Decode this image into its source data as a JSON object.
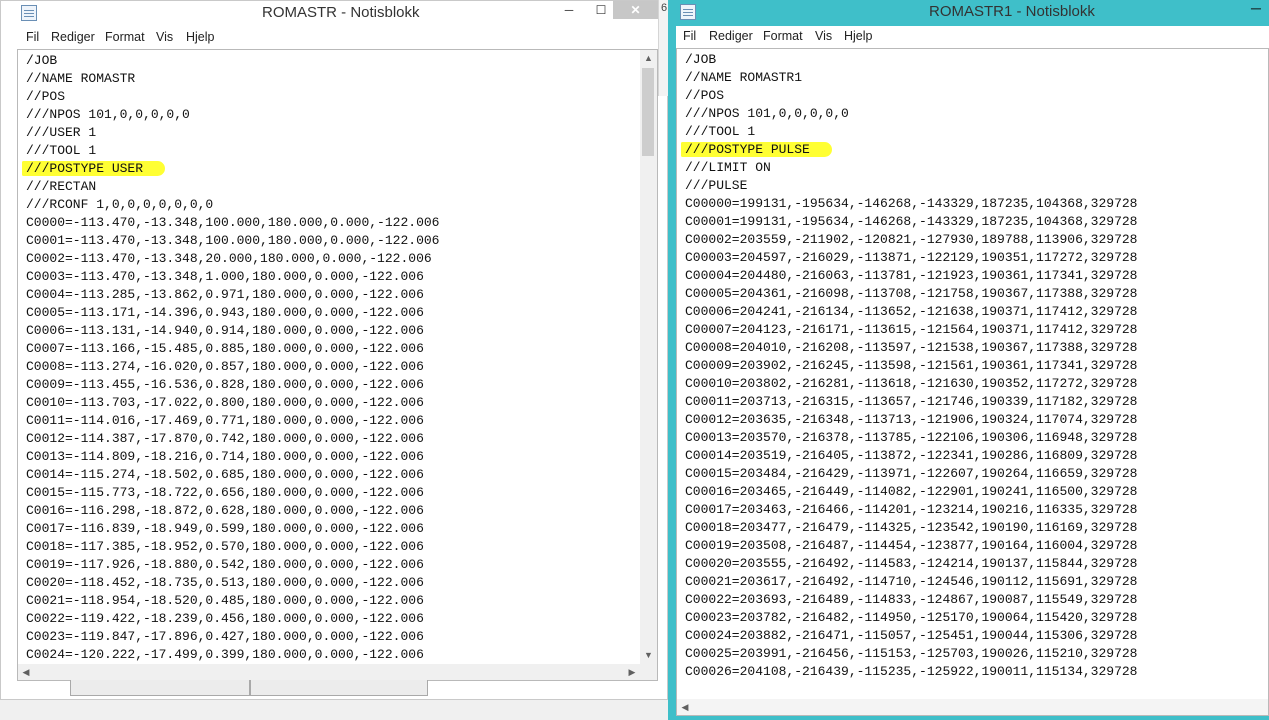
{
  "win1": {
    "title": "ROMASTR - Notisblokk",
    "controls": {
      "minimize": "─",
      "maximize": "☐",
      "close": "✕"
    },
    "menu": [
      "Fil",
      "Rediger",
      "Format",
      "Vis",
      "Hjelp"
    ],
    "lines": [
      "/JOB",
      "//NAME ROMASTR",
      "//POS",
      "///NPOS 101,0,0,0,0,0",
      "///USER 1",
      "///TOOL 1",
      "///POSTYPE USER",
      "///RECTAN",
      "///RCONF 1,0,0,0,0,0,0,0",
      "C0000=-113.470,-13.348,100.000,180.000,0.000,-122.006",
      "C0001=-113.470,-13.348,100.000,180.000,0.000,-122.006",
      "C0002=-113.470,-13.348,20.000,180.000,0.000,-122.006",
      "C0003=-113.470,-13.348,1.000,180.000,0.000,-122.006",
      "C0004=-113.285,-13.862,0.971,180.000,0.000,-122.006",
      "C0005=-113.171,-14.396,0.943,180.000,0.000,-122.006",
      "C0006=-113.131,-14.940,0.914,180.000,0.000,-122.006",
      "C0007=-113.166,-15.485,0.885,180.000,0.000,-122.006",
      "C0008=-113.274,-16.020,0.857,180.000,0.000,-122.006",
      "C0009=-113.455,-16.536,0.828,180.000,0.000,-122.006",
      "C0010=-113.703,-17.022,0.800,180.000,0.000,-122.006",
      "C0011=-114.016,-17.469,0.771,180.000,0.000,-122.006",
      "C0012=-114.387,-17.870,0.742,180.000,0.000,-122.006",
      "C0013=-114.809,-18.216,0.714,180.000,0.000,-122.006",
      "C0014=-115.274,-18.502,0.685,180.000,0.000,-122.006",
      "C0015=-115.773,-18.722,0.656,180.000,0.000,-122.006",
      "C0016=-116.298,-18.872,0.628,180.000,0.000,-122.006",
      "C0017=-116.839,-18.949,0.599,180.000,0.000,-122.006",
      "C0018=-117.385,-18.952,0.570,180.000,0.000,-122.006",
      "C0019=-117.926,-18.880,0.542,180.000,0.000,-122.006",
      "C0020=-118.452,-18.735,0.513,180.000,0.000,-122.006",
      "C0021=-118.954,-18.520,0.485,180.000,0.000,-122.006",
      "C0022=-119.422,-18.239,0.456,180.000,0.000,-122.006",
      "C0023=-119.847,-17.896,0.427,180.000,0.000,-122.006",
      "C0024=-120.222,-17.499,0.399,180.000,0.000,-122.006"
    ],
    "highlight_line": "///POSTYPE USER"
  },
  "win2": {
    "title": "ROMASTR1 - Notisblokk",
    "menu": [
      "Fil",
      "Rediger",
      "Format",
      "Vis",
      "Hjelp"
    ],
    "lines": [
      "/JOB",
      "//NAME ROMASTR1",
      "//POS",
      "///NPOS 101,0,0,0,0,0",
      "///TOOL 1",
      "///POSTYPE PULSE",
      "///LIMIT ON",
      "///PULSE",
      "C00000=199131,-195634,-146268,-143329,187235,104368,329728",
      "C00001=199131,-195634,-146268,-143329,187235,104368,329728",
      "C00002=203559,-211902,-120821,-127930,189788,113906,329728",
      "C00003=204597,-216029,-113871,-122129,190351,117272,329728",
      "C00004=204480,-216063,-113781,-121923,190361,117341,329728",
      "C00005=204361,-216098,-113708,-121758,190367,117388,329728",
      "C00006=204241,-216134,-113652,-121638,190371,117412,329728",
      "C00007=204123,-216171,-113615,-121564,190371,117412,329728",
      "C00008=204010,-216208,-113597,-121538,190367,117388,329728",
      "C00009=203902,-216245,-113598,-121561,190361,117341,329728",
      "C00010=203802,-216281,-113618,-121630,190352,117272,329728",
      "C00011=203713,-216315,-113657,-121746,190339,117182,329728",
      "C00012=203635,-216348,-113713,-121906,190324,117074,329728",
      "C00013=203570,-216378,-113785,-122106,190306,116948,329728",
      "C00014=203519,-216405,-113872,-122341,190286,116809,329728",
      "C00015=203484,-216429,-113971,-122607,190264,116659,329728",
      "C00016=203465,-216449,-114082,-122901,190241,116500,329728",
      "C00017=203463,-216466,-114201,-123214,190216,116335,329728",
      "C00018=203477,-216479,-114325,-123542,190190,116169,329728",
      "C00019=203508,-216487,-114454,-123877,190164,116004,329728",
      "C00020=203555,-216492,-114583,-124214,190137,115844,329728",
      "C00021=203617,-216492,-114710,-124546,190112,115691,329728",
      "C00022=203693,-216489,-114833,-124867,190087,115549,329728",
      "C00023=203782,-216482,-114950,-125170,190064,115420,329728",
      "C00024=203882,-216471,-115057,-125451,190044,115306,329728",
      "C00025=203991,-216456,-115153,-125703,190026,115210,329728",
      "C00026=204108,-216439,-115235,-125922,190011,115134,329728"
    ],
    "highlight_line": "///POSTYPE PULSE"
  },
  "colors": {
    "highlight": "#ffff33",
    "active_title": "#3fbfc9",
    "close_inactive": "#c7c7c7"
  },
  "background_window": {
    "edge_text": "6"
  }
}
